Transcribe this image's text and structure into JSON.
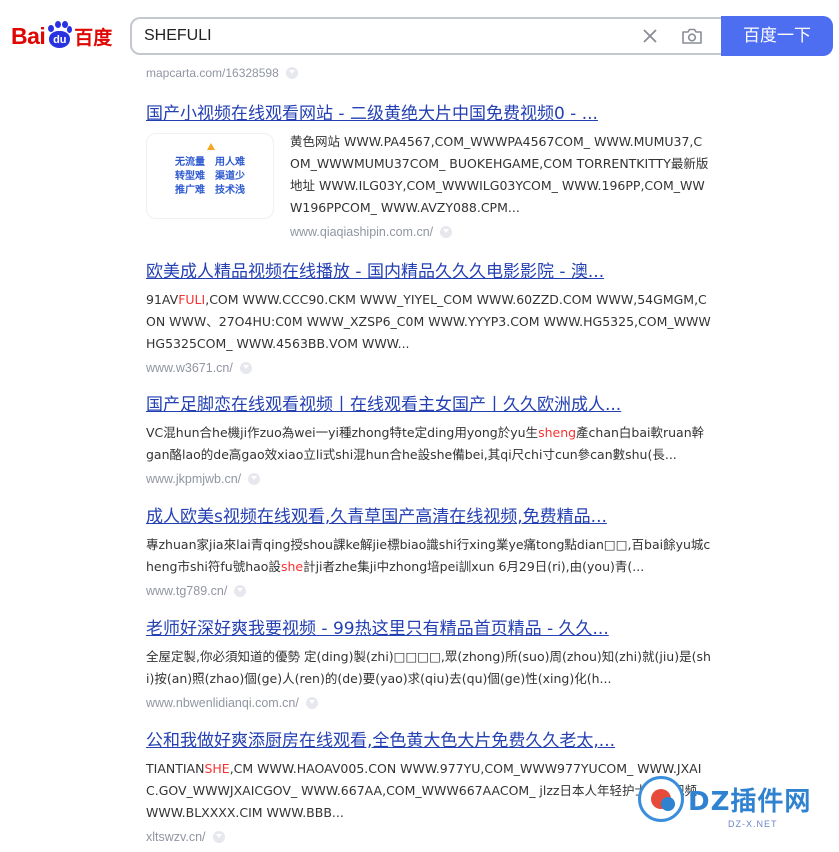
{
  "header": {
    "logo_bai": "Bai",
    "logo_du": "du",
    "logo_cn": "百度",
    "search_value": "SHEFULI",
    "search_button": "百度一下"
  },
  "top_url": "mapcarta.com/16328598",
  "thumbnail": {
    "cells": [
      "无流量",
      "用人难",
      "转型难",
      "渠道少",
      "推广难",
      "技术浅"
    ]
  },
  "results": [
    {
      "title": "国产小视频在线观看网站 - 二级黄绝大片中国免费视频0 - ...",
      "abstract_parts": [
        "黄色网站 WWW.PA4567,COM_WWWPA4567COM_ WWW.MUMU37,COM_WWWMUMU37COM_ BUOKEHGAME,COM TORRENTKITTY最新版地址 WWW.ILG03Y,COM_WWWILG03YCOM_ WWW.196PP,COM_WWW196PPCOM_ WWW.AVZY088.CPM..."
      ],
      "url": "www.qiaqiashipin.com.cn/"
    },
    {
      "title": "欧美成人精品视频在线播放 - 国内精品久久久电影影院 - 澳...",
      "abstract_parts": [
        "91AV",
        "FULI",
        ",COM WWW.CCC90.CKM WWW_YIYEL_COM WWW.60ZZD.COM WWW,54GMGM,CON WWW、27O4HU:C0M WWW_XZSP6_C0M WWW.YYYP3.COM WWW.HG5325,COM_WWWHG5325COM_ WWW.4563BB.VOM WWW..."
      ],
      "url": "www.w3671.cn/"
    },
    {
      "title": "国产足脚恋在线观看视频丨在线观看主女国产丨久久欧洲成人...",
      "abstract_parts": [
        "VC混hun合he機ji作zuo為wei一yi種zhong特te定ding用yong於yu生",
        "sheng",
        "產chan白bai軟ruan幹gan酪lao的de高gao效xiao立li式shi混hun合he設she備bei,其qi尺chi寸cun參can數shu(長..."
      ],
      "url": "www.jkpmjwb.cn/"
    },
    {
      "title": "成人欧美s视频在线观看,久青草国产高清在线视频,免费精品...",
      "abstract_parts": [
        "專zhuan家jia來lai青qing授shou課ke解jie標biao識shi行xing業ye痛tong點dian□□,百bai餘yu城cheng市shi符fu號hao設",
        "she",
        "計ji者zhe集ji中zhong培pei訓xun 6月29日(ri),由(you)青(..."
      ],
      "url": "www.tg789.cn/"
    },
    {
      "title": "老师好深好爽我要视频 - 99热这里只有精品首页精品 - 久久...",
      "abstract_parts": [
        "全屋定製,你必須知道的優勢 定(ding)製(zhi)□□□□,眾(zhong)所(suo)周(zhou)知(zhi)就(jiu)是(shi)按(an)照(zhao)個(ge)人(ren)的(de)要(yao)求(qiu)去(qu)個(ge)性(xing)化(h..."
      ],
      "url": "www.nbwenlidianqi.com.cn/"
    },
    {
      "title": "公和我做好爽添厨房在线观看,全色黄大色大片免费久久老太,...",
      "abstract_parts": [
        "TIANTIAN",
        "SHE",
        ",CM WWW.HAOAV005.CON WWW.977YU,COM_WWW977YUCOM_ WWW.JXAIC.GOV_WWWJXAICGOV_ WWW.667AA,COM_WWW667AACOM_ jlzz日本人年轻护士出水视频 WWW.BLXXXX.CIM WWW.BBB..."
      ],
      "url": "xltswzv.cn/"
    }
  ],
  "watermark": {
    "text": "DZ插件网",
    "sub": "DZ-X.NET"
  }
}
